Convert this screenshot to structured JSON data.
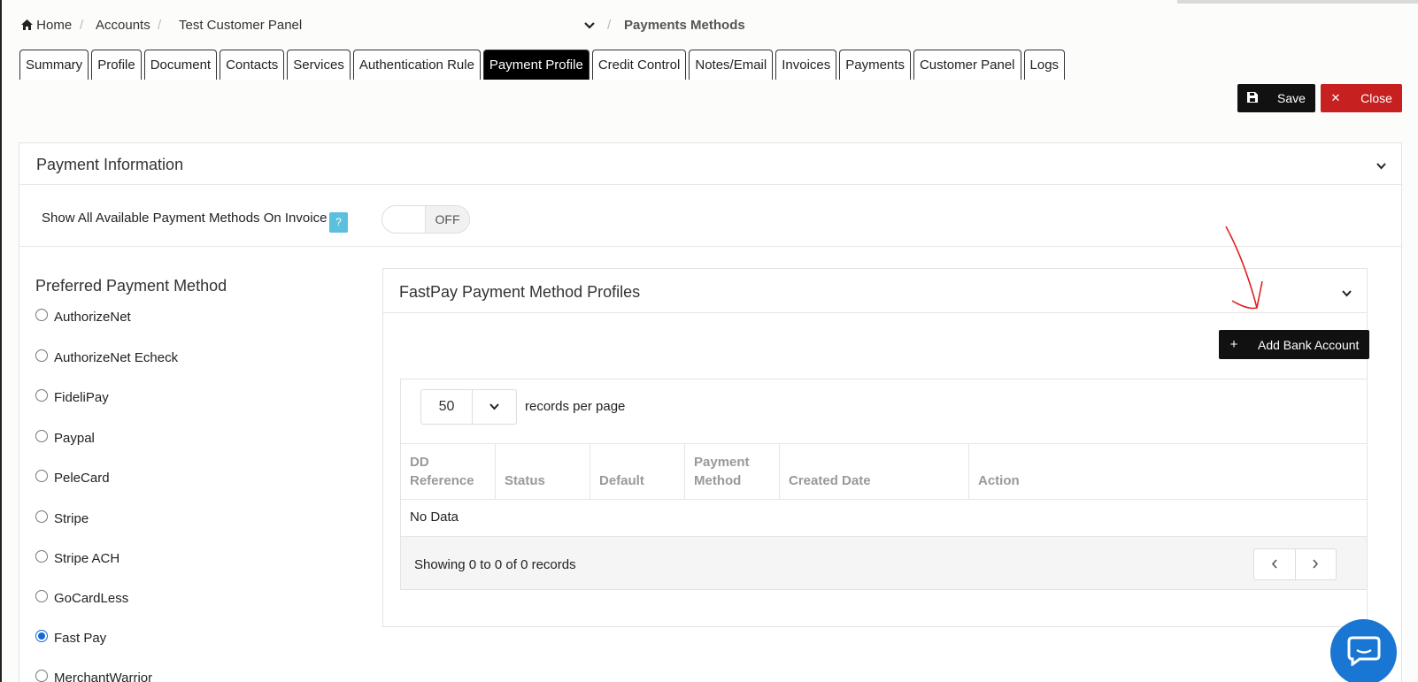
{
  "breadcrumb": {
    "home": "Home",
    "sep": "/",
    "accounts": "Accounts",
    "customer": "Test Customer Panel",
    "current": "Payments Methods"
  },
  "tabs": [
    {
      "label": "Summary",
      "active": false
    },
    {
      "label": "Profile",
      "active": false
    },
    {
      "label": "Document",
      "active": false
    },
    {
      "label": "Contacts",
      "active": false
    },
    {
      "label": "Services",
      "active": false
    },
    {
      "label": "Authentication Rule",
      "active": false
    },
    {
      "label": "Payment Profile",
      "active": true
    },
    {
      "label": "Credit Control",
      "active": false
    },
    {
      "label": "Notes/Email",
      "active": false
    },
    {
      "label": "Invoices",
      "active": false
    },
    {
      "label": "Payments",
      "active": false
    },
    {
      "label": "Customer Panel",
      "active": false
    },
    {
      "label": "Logs",
      "active": false
    }
  ],
  "toolbar": {
    "save_label": "Save",
    "close_label": "Close"
  },
  "payment_info": {
    "title": "Payment Information",
    "show_all_label": "Show All Available Payment Methods On Invoice",
    "help": "?",
    "toggle_state": "OFF"
  },
  "preferred": {
    "title": "Preferred Payment Method",
    "options": [
      {
        "label": "AuthorizeNet",
        "checked": false
      },
      {
        "label": "AuthorizeNet Echeck",
        "checked": false
      },
      {
        "label": "FideliPay",
        "checked": false
      },
      {
        "label": "Paypal",
        "checked": false
      },
      {
        "label": "PeleCard",
        "checked": false
      },
      {
        "label": "Stripe",
        "checked": false
      },
      {
        "label": "Stripe ACH",
        "checked": false
      },
      {
        "label": "GoCardLess",
        "checked": false
      },
      {
        "label": "Fast Pay",
        "checked": true
      },
      {
        "label": "MerchantWarrior",
        "checked": false
      }
    ]
  },
  "fastpay": {
    "title": "FastPay Payment Method Profiles",
    "add_label": "Add Bank Account",
    "page_length": "50",
    "records_label": "records per page",
    "columns": [
      "DD Reference",
      "Status",
      "Default",
      "Payment Method",
      "Created Date",
      "Action"
    ],
    "empty": "No Data",
    "info": "Showing 0 to 0 of 0 records"
  },
  "colors": {
    "accent": "#000000",
    "danger": "#c62020",
    "help": "#5bc0de",
    "chat": "#1976d2",
    "annotation": "#e02020"
  }
}
